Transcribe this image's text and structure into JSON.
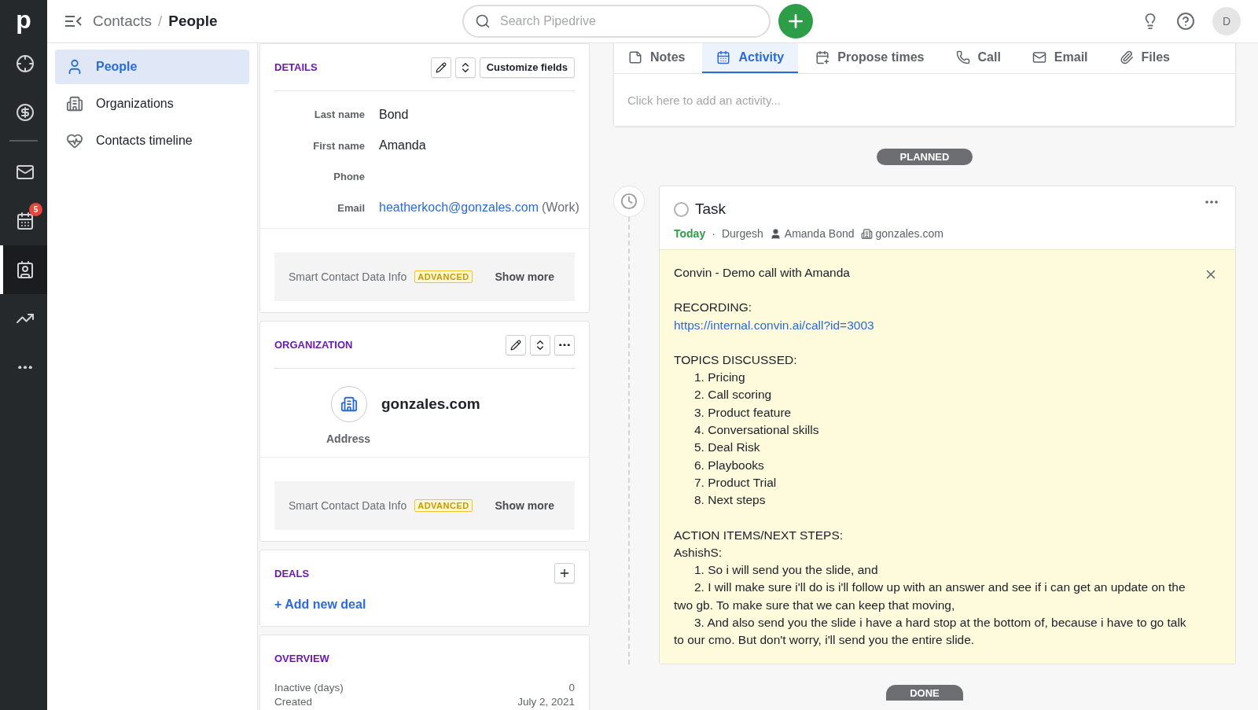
{
  "rail": {
    "logo": "p",
    "items": [
      {
        "selected": false
      },
      {
        "selected": false
      },
      {
        "selected": false
      },
      {
        "selected": false,
        "badge": "5"
      },
      {
        "selected": true
      },
      {
        "selected": false
      },
      {
        "selected": false
      }
    ]
  },
  "topbar": {
    "breadcrumb": [
      "Contacts",
      "People"
    ],
    "breadcrumb_separator": "/",
    "search": {
      "placeholder": "Search Pipedrive"
    },
    "avatar": "D"
  },
  "subnav": [
    {
      "label": "People",
      "selected": true
    },
    {
      "label": "Organizations",
      "selected": false
    },
    {
      "label": "Contacts timeline",
      "selected": false
    }
  ],
  "details": {
    "title": "DETAILS",
    "customize": "Customize fields",
    "fields": [
      {
        "label": "Last name",
        "value": "Bond"
      },
      {
        "label": "First name",
        "value": "Amanda"
      },
      {
        "label": "Phone"
      },
      {
        "label": "Email",
        "value": "heatherkoch@gonzales.com",
        "note": "(Work)"
      }
    ],
    "smart": {
      "label": "Smart Contact Data Info",
      "badge": "ADVANCED",
      "action": "Show more"
    }
  },
  "organization": {
    "title": "ORGANIZATION",
    "name": "gonzales.com",
    "address_label": "Address",
    "smart": {
      "label": "Smart Contact Data Info",
      "badge": "ADVANCED",
      "action": "Show more"
    }
  },
  "deals": {
    "title": "DEALS",
    "add": "+ Add new deal"
  },
  "overview": {
    "title": "OVERVIEW",
    "rows": [
      {
        "label": "Inactive (days)",
        "value": "0"
      },
      {
        "label": "Created",
        "value": "July 2, 2021"
      }
    ]
  },
  "composer": {
    "tabs": [
      {
        "label": "Notes",
        "selected": false
      },
      {
        "label": "Activity",
        "selected": true
      },
      {
        "label": "Propose times",
        "selected": false
      },
      {
        "label": "Call",
        "selected": false
      },
      {
        "label": "Email",
        "selected": false
      },
      {
        "label": "Files",
        "selected": false
      }
    ],
    "placeholder": "Click here to add an activity..."
  },
  "planned_label": "PLANNED",
  "task": {
    "title": "Task",
    "done": false,
    "due": "Today",
    "meta_separator": "·",
    "owner": "Durgesh",
    "person": "Amanda Bond",
    "org": "gonzales.com",
    "note": [
      {
        "kind": "text",
        "text": "Convin - Demo call with Amanda"
      },
      {
        "kind": "blank"
      },
      {
        "kind": "text",
        "text": "RECORDING:"
      },
      {
        "kind": "link",
        "text": "https://internal.convin.ai/call?id=3003"
      },
      {
        "kind": "blank"
      },
      {
        "kind": "text",
        "text": "TOPICS DISCUSSED:"
      },
      {
        "kind": "item",
        "text": "1. Pricing"
      },
      {
        "kind": "item",
        "text": "2. Call scoring"
      },
      {
        "kind": "item",
        "text": "3. Product feature"
      },
      {
        "kind": "item",
        "text": "4. Conversational skills"
      },
      {
        "kind": "item",
        "text": "5. Deal Risk"
      },
      {
        "kind": "item",
        "text": "6. Playbooks"
      },
      {
        "kind": "item",
        "text": "7. Product Trial"
      },
      {
        "kind": "item",
        "text": "8. Next steps"
      },
      {
        "kind": "blank"
      },
      {
        "kind": "text",
        "text": "ACTION ITEMS/NEXT STEPS:"
      },
      {
        "kind": "text",
        "text": "AshishS:"
      },
      {
        "kind": "item",
        "text": "1. So i will send you the slide, and"
      },
      {
        "kind": "item",
        "text": "2. I will make sure i'll do is i'll follow up with an answer and see if i can get an update on the two gb. To make sure that we can keep that moving,"
      },
      {
        "kind": "item",
        "text": "3. And also send you the slide i have a hard stop at the bottom of, because i have to go talk to our cmo. But don't worry, i'll send you the entire slide."
      }
    ]
  },
  "done_label": "DONE"
}
